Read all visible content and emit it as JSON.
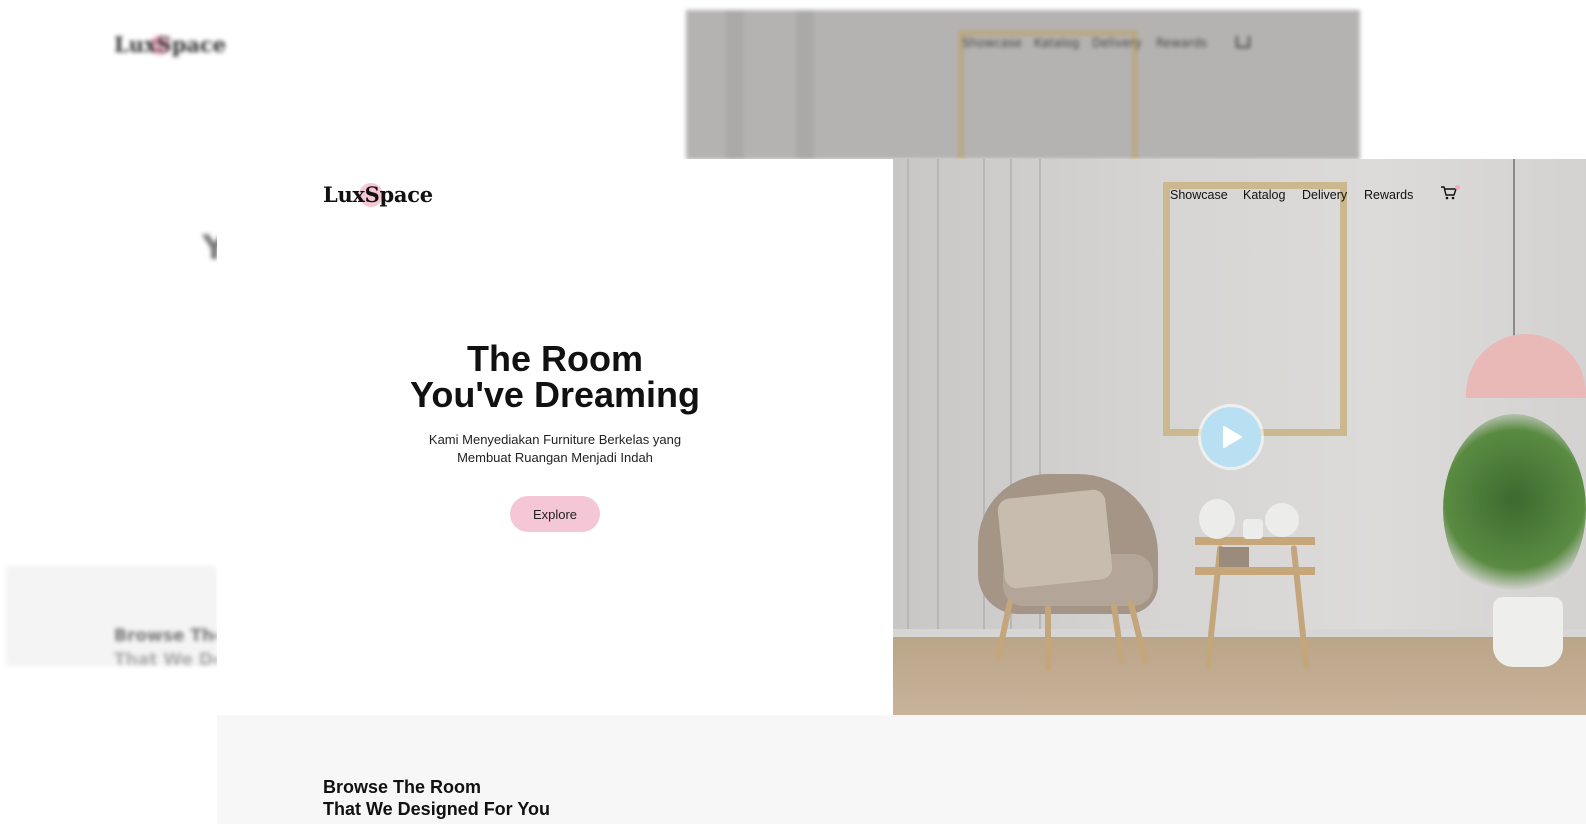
{
  "brand": {
    "name": "LuxSpace",
    "accent": "#f6c7d5"
  },
  "nav": {
    "items": [
      "Showcase",
      "Katalog",
      "Delivery",
      "Rewards"
    ],
    "cart_icon": "cart-icon"
  },
  "hero": {
    "title_line1": "The Room",
    "title_line2": "You've Dreaming",
    "subtitle_line1": "Kami Menyediakan Furniture Berkelas yang",
    "subtitle_line2": "Membuat Ruangan Menjadi Indah",
    "cta_label": "Explore",
    "play_icon": "play-icon",
    "play_color": "#b9dff2"
  },
  "section": {
    "title_line1": "Browse The Room",
    "title_line2": "That We Designed For You"
  },
  "background_copy": {
    "logo": "LuxSpace",
    "nav_items": [
      "Showcase",
      "Katalog",
      "Delivery",
      "Rewards"
    ],
    "title_fragment": "Y",
    "section_line1": "Browse The Room",
    "section_line2": "That We Designed For You"
  }
}
